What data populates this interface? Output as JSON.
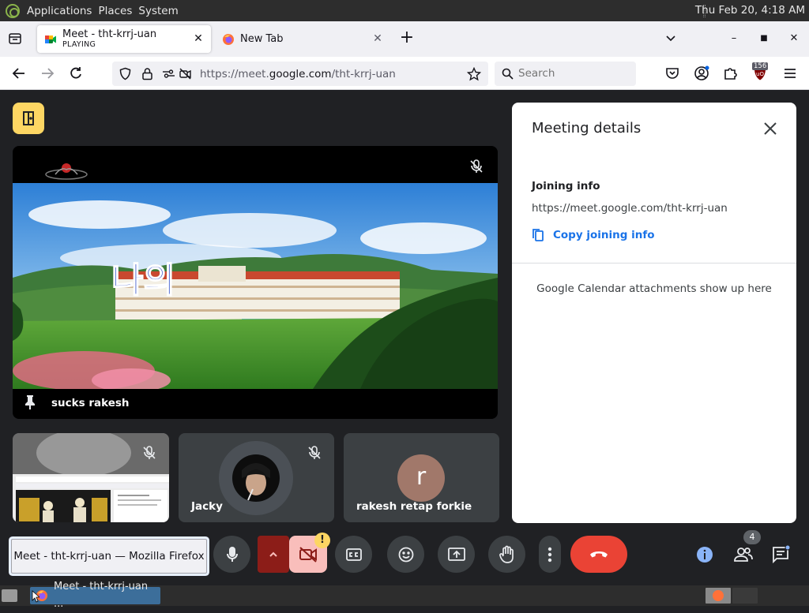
{
  "gnome_panel": {
    "menus": [
      "Applications",
      "Places",
      "System"
    ],
    "clock": "Thu Feb 20,  4:18 AM"
  },
  "tabs": [
    {
      "title": "Meet - tht-krrj-uan",
      "subtitle": "PLAYING",
      "active": true
    },
    {
      "title": "New Tab",
      "subtitle": "",
      "active": false
    }
  ],
  "navbar": {
    "url_prefix": "https://meet.",
    "url_domain": "google.com",
    "url_path": "/tht-krrj-uan",
    "search_placeholder": "Search",
    "ublock_count": "156"
  },
  "meet": {
    "main_tile": {
      "name": "sucks rakesh",
      "muted": true
    },
    "small_tiles": [
      {
        "name": "",
        "muted": true,
        "type": "video"
      },
      {
        "name": "Jacky",
        "muted": true,
        "type": "avatar-photo"
      },
      {
        "name": "rakesh retap forkie",
        "muted": false,
        "type": "avatar-letter",
        "letter": "r"
      }
    ],
    "side_panel": {
      "title": "Meeting details",
      "joining_heading": "Joining info",
      "joining_url": "https://meet.google.com/tht-krrj-uan",
      "copy_label": "Copy joining info",
      "calendar_note": "Google Calendar attachments show up here"
    },
    "controls": {
      "camera_alert": "!",
      "people_count": "4"
    },
    "colors": {
      "hangup": "#ea4335",
      "link_blue": "#1a73e8",
      "host_yellow": "#fdd663",
      "camera_off_bg": "#f9bebb",
      "mic_options_bg": "#8c1d18"
    }
  },
  "tooltip": {
    "text": "Meet - tht-krrj-uan — Mozilla Firefox"
  },
  "taskbar": {
    "item_label": "Meet - tht-krrj-uan ..."
  }
}
